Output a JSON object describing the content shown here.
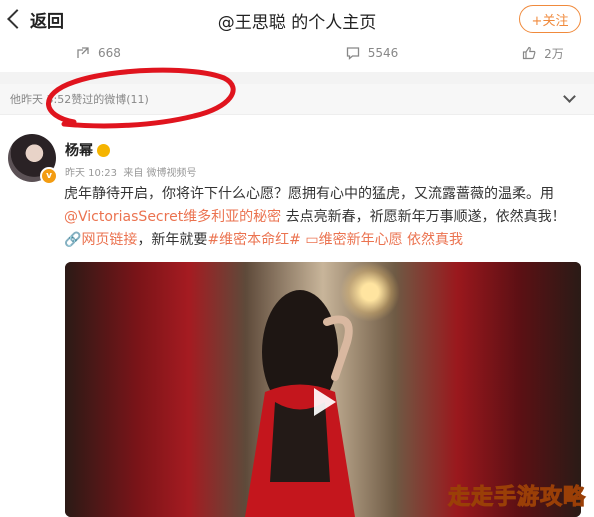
{
  "header": {
    "back_label": "返回",
    "title": "@王思聪 的个人主页",
    "follow_label": "+关注"
  },
  "stats": {
    "share_count": "668",
    "comment_count": "5546",
    "like_count": "2万"
  },
  "liked_section": {
    "label": "他昨天 3:52赞过的微博(11)"
  },
  "post": {
    "author": "杨幂",
    "time": "昨天 10:23",
    "source": "来自 微博视频号",
    "text_1": "虎年静待开启，你将许下什么心愿？愿拥有心中的猛虎，又流露蔷薇的温柔。用",
    "mention": "@VictoriasSecret维多利亚的秘密",
    "text_2": " 去点亮新春，祈愿新年万事顺遂，依然真我！",
    "web_link": "网页链接",
    "text_3": "，新年就要",
    "hashtag_1": "#维密本命红#",
    "video_link": "维密新年心愿 依然真我"
  },
  "watermark": "走走手游攻略",
  "colors": {
    "accent": "#eb7350",
    "follow": "#f08a3c",
    "annotation": "#e0141e"
  }
}
